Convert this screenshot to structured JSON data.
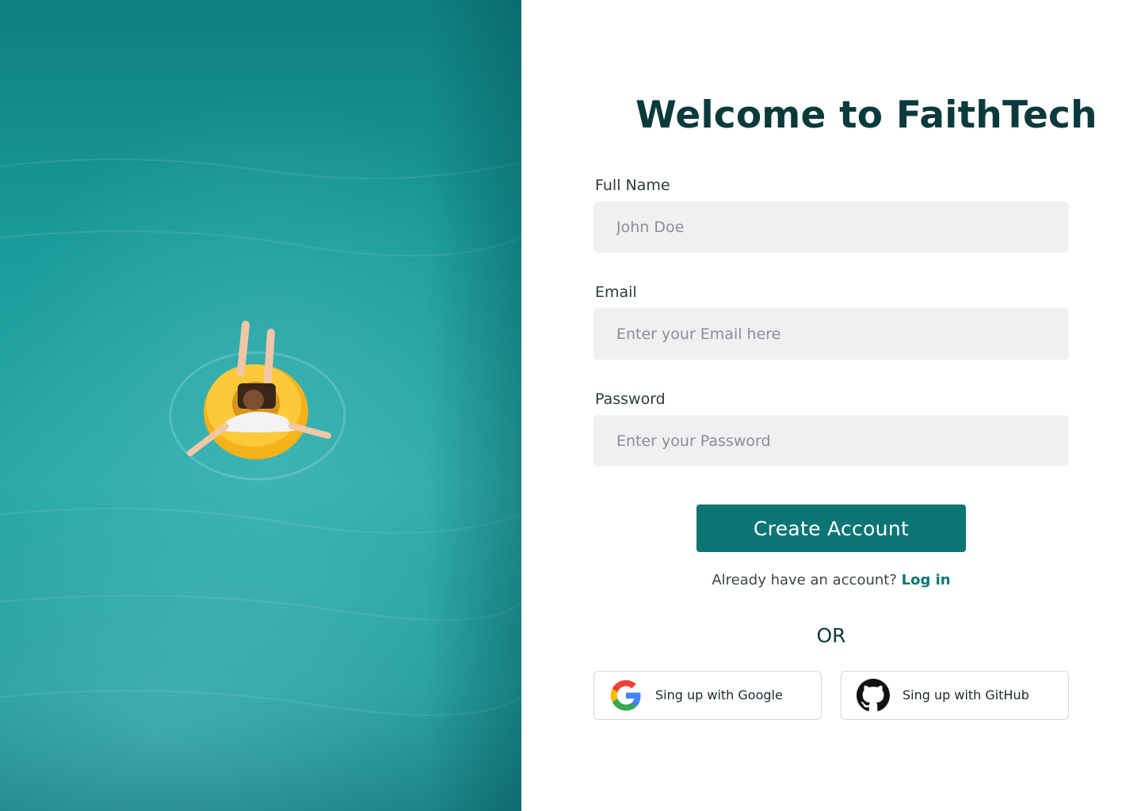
{
  "hero": {
    "image_description_icon": "photo-person-on-yellow-float-in-turquoise-water"
  },
  "title": "Welcome to FaithTech",
  "form": {
    "full_name": {
      "label": "Full Name",
      "placeholder": "John Doe",
      "value": ""
    },
    "email": {
      "label": "Email",
      "placeholder": "Enter your Email here",
      "value": ""
    },
    "password": {
      "label": "Password",
      "placeholder": "Enter your Password",
      "value": ""
    },
    "submit_label": "Create Account"
  },
  "login": {
    "prompt": "Already have an account?",
    "link_label": "Log in"
  },
  "divider": "OR",
  "social": {
    "google": {
      "label": "Sing up with Google",
      "icon": "google-icon"
    },
    "github": {
      "label": "Sing up with GitHub",
      "icon": "github-icon"
    }
  },
  "colors": {
    "primary": "#0b7574",
    "title": "#0b3a3c",
    "input_bg": "#eff0f2"
  }
}
